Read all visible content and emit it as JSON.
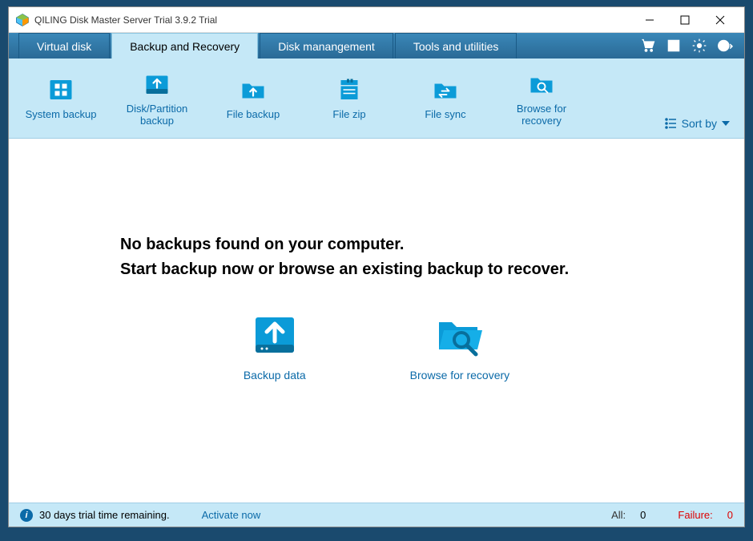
{
  "titlebar": {
    "title": "QILING Disk Master Server Trial 3.9.2 Trial"
  },
  "tabs": {
    "virtual_disk": "Virtual disk",
    "backup_recovery": "Backup and Recovery",
    "disk_management": "Disk manangement",
    "tools_utilities": "Tools and utilities"
  },
  "toolbar": {
    "system_backup": "System backup",
    "disk_partition_backup": "Disk/Partition\nbackup",
    "file_backup": "File backup",
    "file_zip": "File zip",
    "file_sync": "File sync",
    "browse_recovery": "Browse for\nrecovery",
    "sort_by": "Sort by"
  },
  "main": {
    "msg1": "No backups found on your computer.",
    "msg2": "Start backup now or browse an existing backup to recover.",
    "backup_data": "Backup data",
    "browse_recovery": "Browse for recovery"
  },
  "statusbar": {
    "trial_msg": "30 days trial time remaining.",
    "activate": "Activate now",
    "all_label": "All:",
    "all_value": "0",
    "failure_label": "Failure:",
    "failure_value": "0"
  }
}
